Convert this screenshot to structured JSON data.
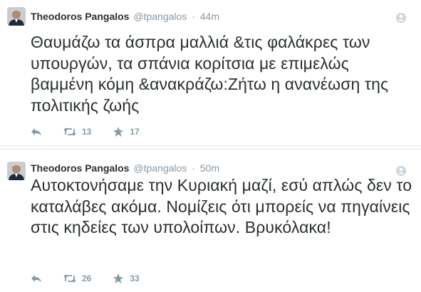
{
  "tweets": [
    {
      "fullname": "Theodoros Pangalos",
      "handle": "@tpangalos",
      "separator": "·",
      "time": "44m",
      "text": "Θαυμάζω τα άσπρα μαλλιά &τις φαλάκρες των υπουργών, τα σπάνια κορίτσια με επιμελώς βαμμένη κόμη &ανακράζω:Ζήτω η ανανέωση της πολιτικής ζωής",
      "retweets": "13",
      "favorites": "17"
    },
    {
      "fullname": "Theodoros Pangalos",
      "handle": "@tpangalos",
      "separator": "·",
      "time": "50m",
      "text": "Αυτοκτονήσαμε την Κυριακή μαζί, εσύ απλώς δεν το καταλάβες ακόμα. Νομίζεις ότι μπορείς να πηγαίνεις στις κηδείες των υπολοίπων. Βρυκόλακα!",
      "retweets": "26",
      "favorites": "33"
    }
  ],
  "colors": {
    "text": "#292f33",
    "muted": "#8899a6",
    "border": "#e1e8ed"
  },
  "icons": {
    "reply": "reply-icon",
    "retweet": "retweet-icon",
    "favorite": "star-icon",
    "follow": "follow-icon"
  }
}
